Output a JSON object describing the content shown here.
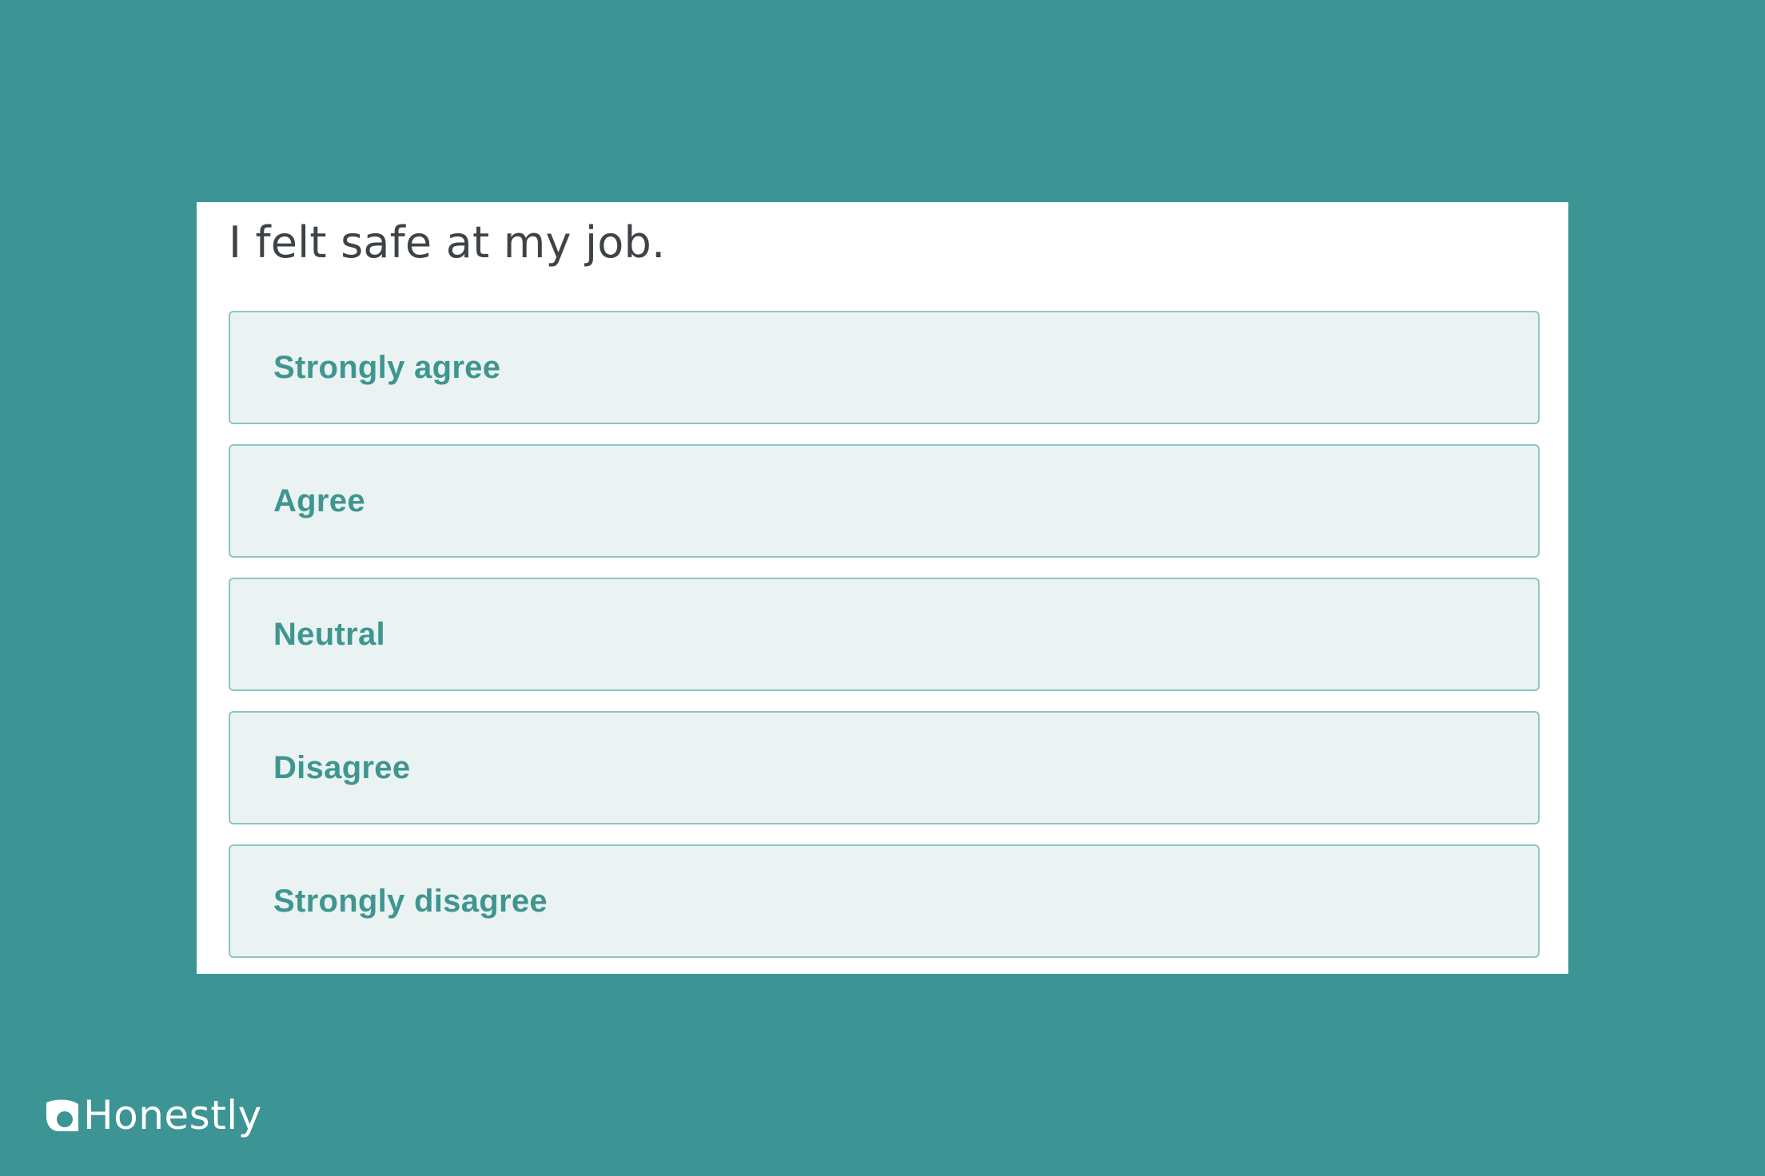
{
  "survey": {
    "question": "I felt safe at my job.",
    "options": [
      {
        "label": "Strongly agree"
      },
      {
        "label": "Agree"
      },
      {
        "label": "Neutral"
      },
      {
        "label": "Disagree"
      },
      {
        "label": "Strongly disagree"
      }
    ]
  },
  "brand": {
    "name": "Honestly",
    "icon": "honestly-logo-icon"
  },
  "colors": {
    "background": "#3d9494",
    "card": "#ffffff",
    "option_fill": "#ebf3f2",
    "option_border": "#8ec5c1",
    "option_text": "#3f9690",
    "question_text": "#3e4347"
  }
}
